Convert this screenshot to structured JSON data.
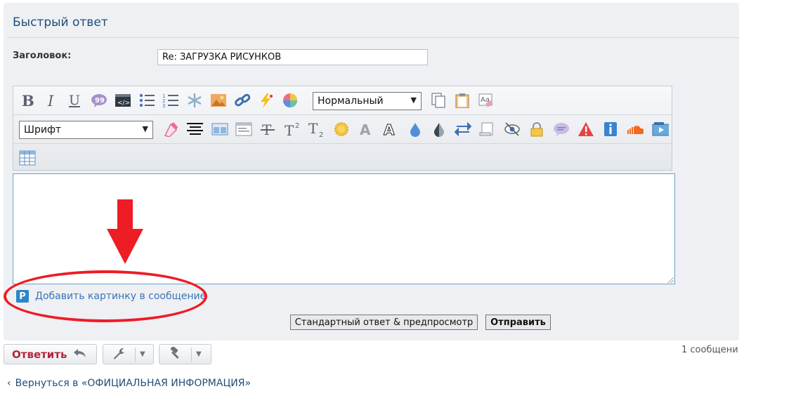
{
  "quick_reply": {
    "title": "Быстрый ответ",
    "subject_label": "Заголовок:",
    "subject_value": "Re: ЗАГРУЗКА РИСУНКОВ",
    "format_select": "Нормальный",
    "font_select": "Шрифт",
    "add_picture_link": "Добавить картинку в сообщение",
    "preview_button": "Стандартный ответ & предпросмотр",
    "send_button": "Отправить"
  },
  "thread_actions": {
    "reply_label": "Ответить",
    "post_count": "1 сообщени"
  },
  "back_link": "Вернуться в «ОФИЦИАЛЬНАЯ ИНФОРМАЦИЯ»",
  "colors": {
    "annotation_red": "#ee1c24",
    "title_blue": "#1f4e79",
    "link_blue": "#3b73b9"
  }
}
